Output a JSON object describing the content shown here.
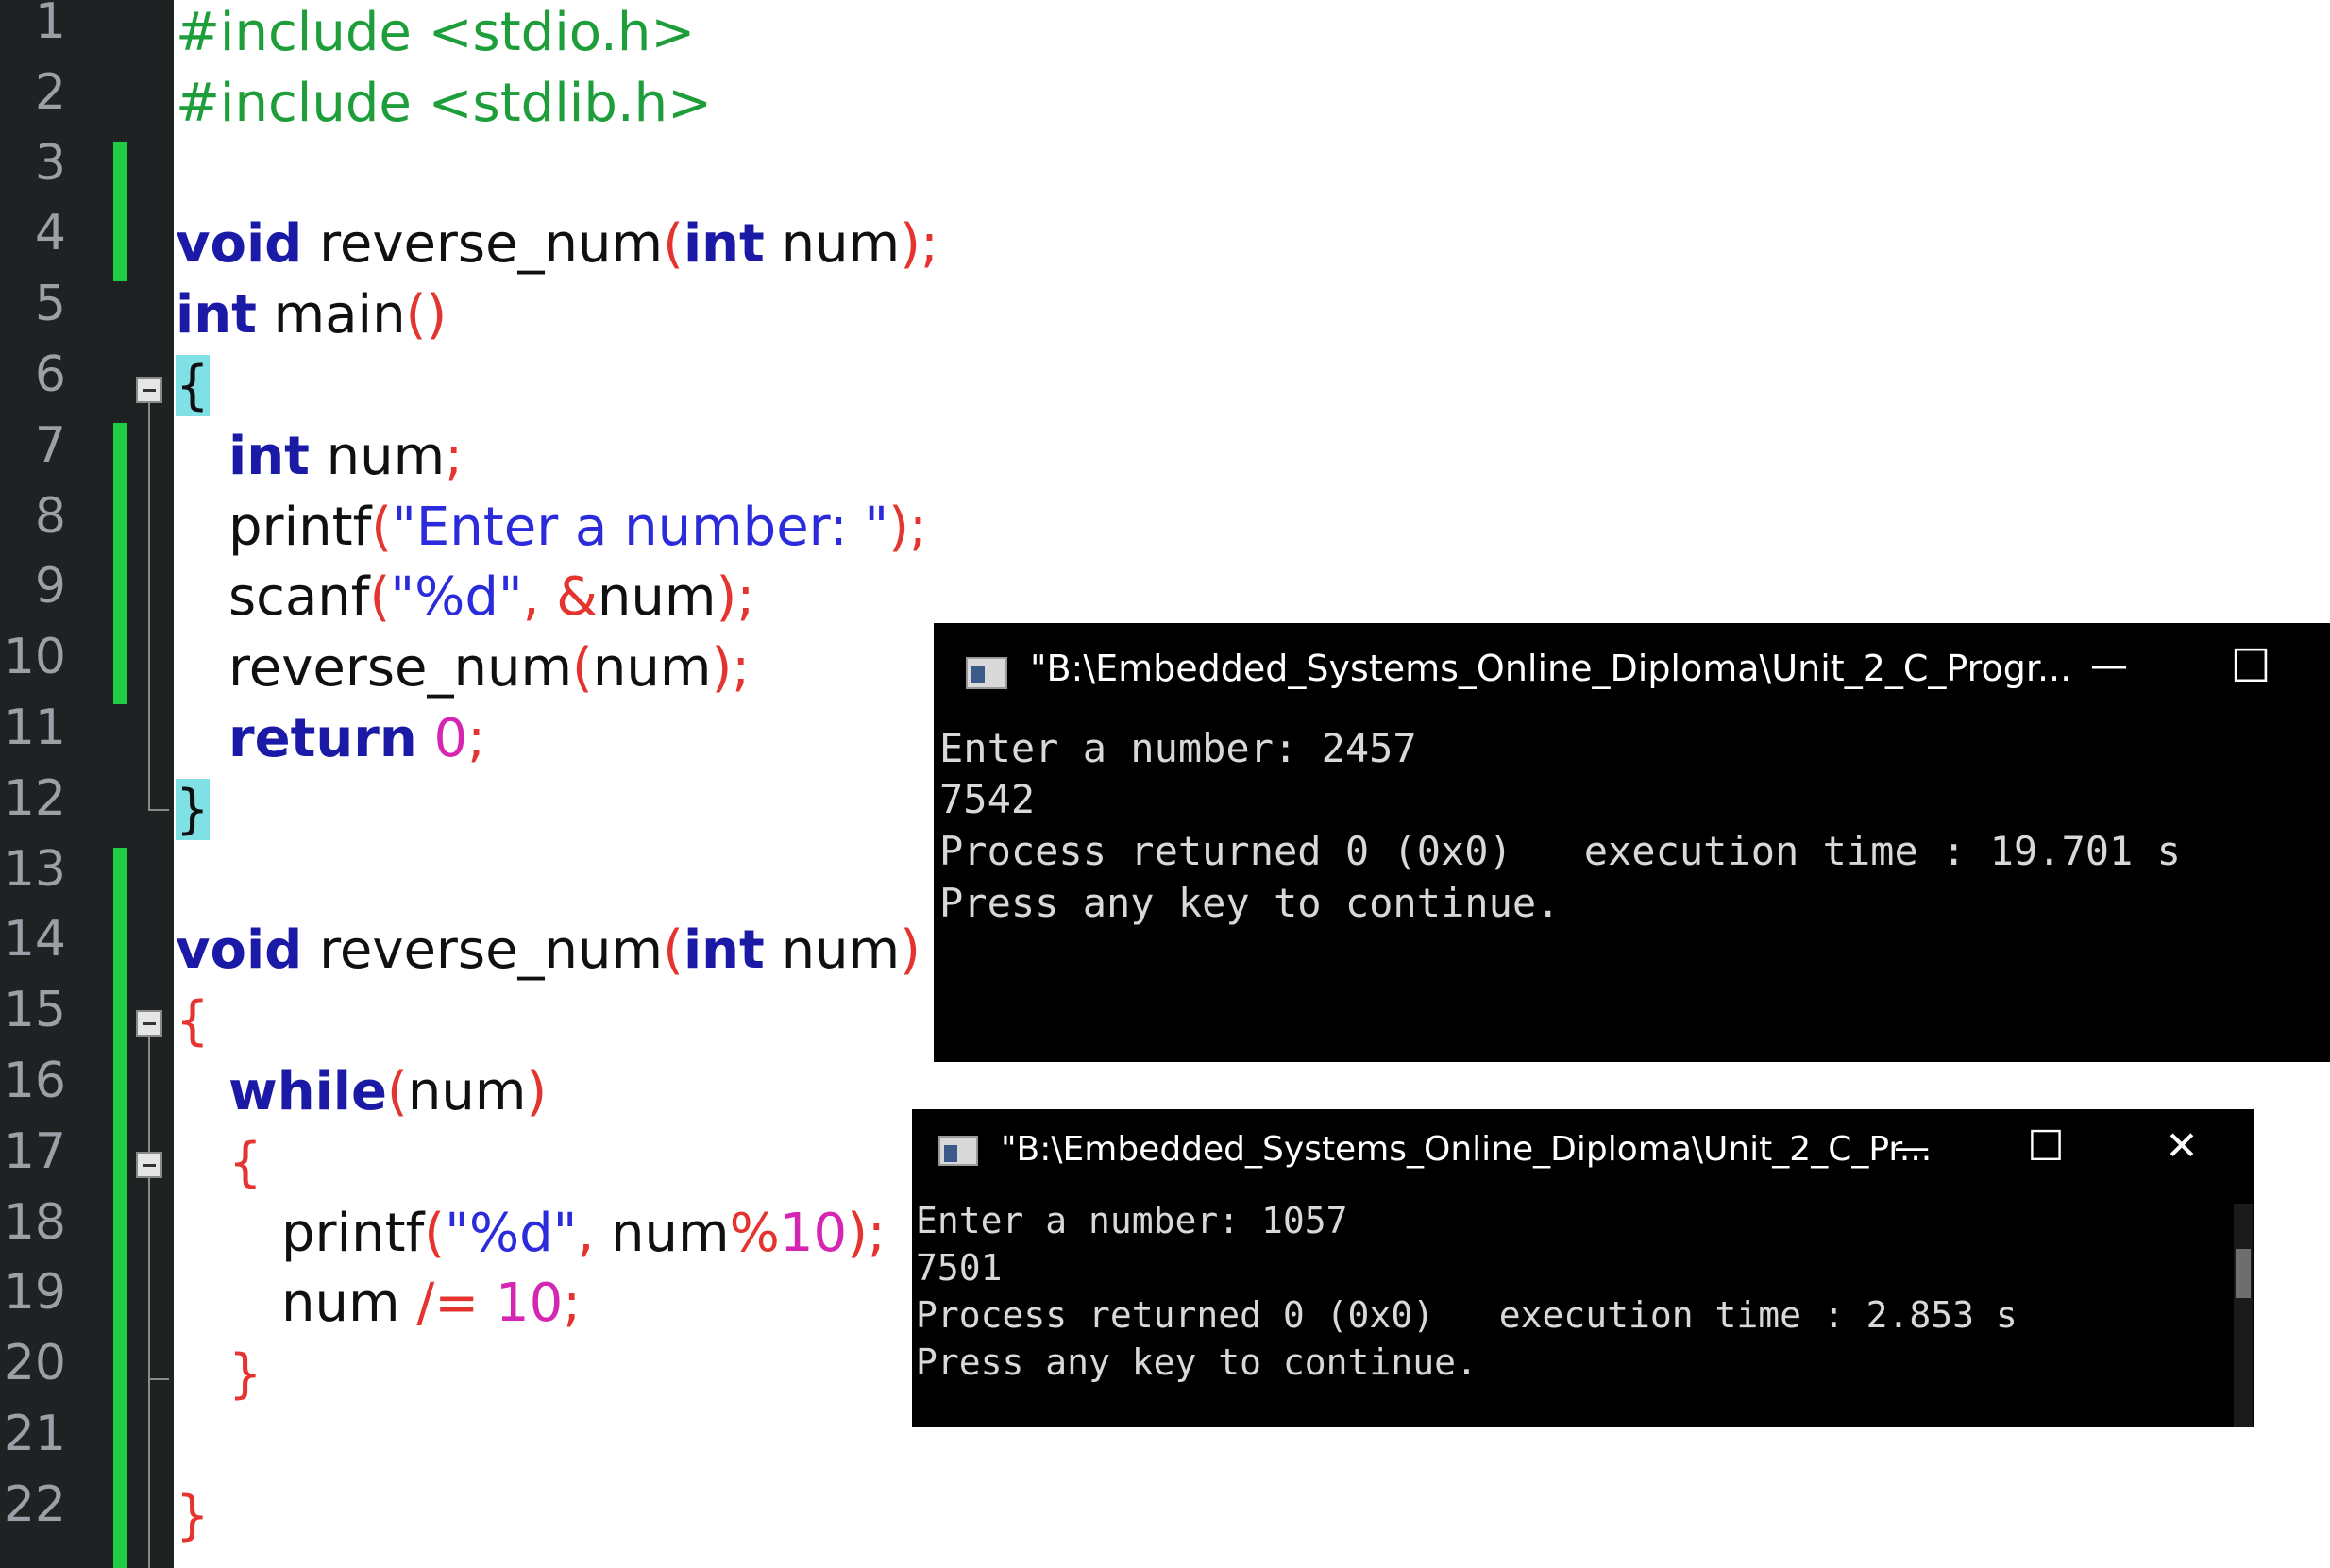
{
  "editor": {
    "line_numbers": [
      "1",
      "2",
      "3",
      "4",
      "5",
      "6",
      "7",
      "8",
      "9",
      "10",
      "11",
      "12",
      "13",
      "14",
      "15",
      "16",
      "17",
      "18",
      "19",
      "20",
      "21",
      "22"
    ],
    "code": {
      "l1": "#include <stdio.h>",
      "l2": "#include <stdlib.h>",
      "l4_void": "void",
      "l4_name": " reverse_num",
      "l4_lp": "(",
      "l4_int": "int",
      "l4_param": " num",
      "l4_rp": ");",
      "l5_int": "int",
      "l5_main": " main",
      "l5_parens": "()",
      "l6_brace": "{",
      "l7_int": "int",
      "l7_rest": " num",
      "l7_semi": ";",
      "l8_printf": "printf",
      "l8_lp": "(",
      "l8_str": "\"Enter a number: \"",
      "l8_rp": ");",
      "l9_scanf": "scanf",
      "l9_lp": "(",
      "l9_str": "\"%d\"",
      "l9_comma": ", &",
      "l9_num": "num",
      "l9_rp": ");",
      "l10_call": "reverse_num",
      "l10_lp": "(",
      "l10_arg": "num",
      "l10_rp": ");",
      "l11_return": "return",
      "l11_zero": " 0",
      "l11_semi": ";",
      "l12_brace": "}",
      "l14_void": "void",
      "l14_name": " reverse_num",
      "l14_lp": "(",
      "l14_int": "int",
      "l14_param": " num",
      "l14_rp": ")",
      "l15_brace": "{",
      "l16_while": "while",
      "l16_lp": "(",
      "l16_arg": "num",
      "l16_rp": ")",
      "l17_brace": "{",
      "l18_printf": "printf",
      "l18_lp": "(",
      "l18_str": "\"%d\"",
      "l18_comma": ", ",
      "l18_num": "num",
      "l18_mod": "%",
      "l18_ten": "10",
      "l18_rp": ");",
      "l19_num": "num",
      "l19_op": " /=",
      "l19_ten": " 10",
      "l19_semi": ";",
      "l20_brace": "}",
      "l22_brace": "}"
    }
  },
  "terminal1": {
    "title": "\"B:\\Embedded_Systems_Online_Diploma\\Unit_2_C_Progr...",
    "minimize": "—",
    "maximize": "☐",
    "lines": [
      "Enter a number: 2457",
      "7542",
      "Process returned 0 (0x0)   execution time : 19.701 s",
      "Press any key to continue."
    ]
  },
  "terminal2": {
    "title": "\"B:\\Embedded_Systems_Online_Diploma\\Unit_2_C_Pr...",
    "minimize": "—",
    "maximize": "☐",
    "close": "✕",
    "lines": [
      "Enter a number: 1057",
      "7501",
      "Process returned 0 (0x0)   execution time : 2.853 s",
      "Press any key to continue."
    ]
  },
  "colors": {
    "gutter": "#1f2223",
    "change_marker": "#22cc44",
    "keyword": "#1a1aa6",
    "preprocessor": "#1e9e3a",
    "operator": "#e3342f",
    "string": "#2b2bdb",
    "number": "#d426b2",
    "brace_highlight": "#7fe0e6",
    "terminal_bg": "#000000"
  }
}
